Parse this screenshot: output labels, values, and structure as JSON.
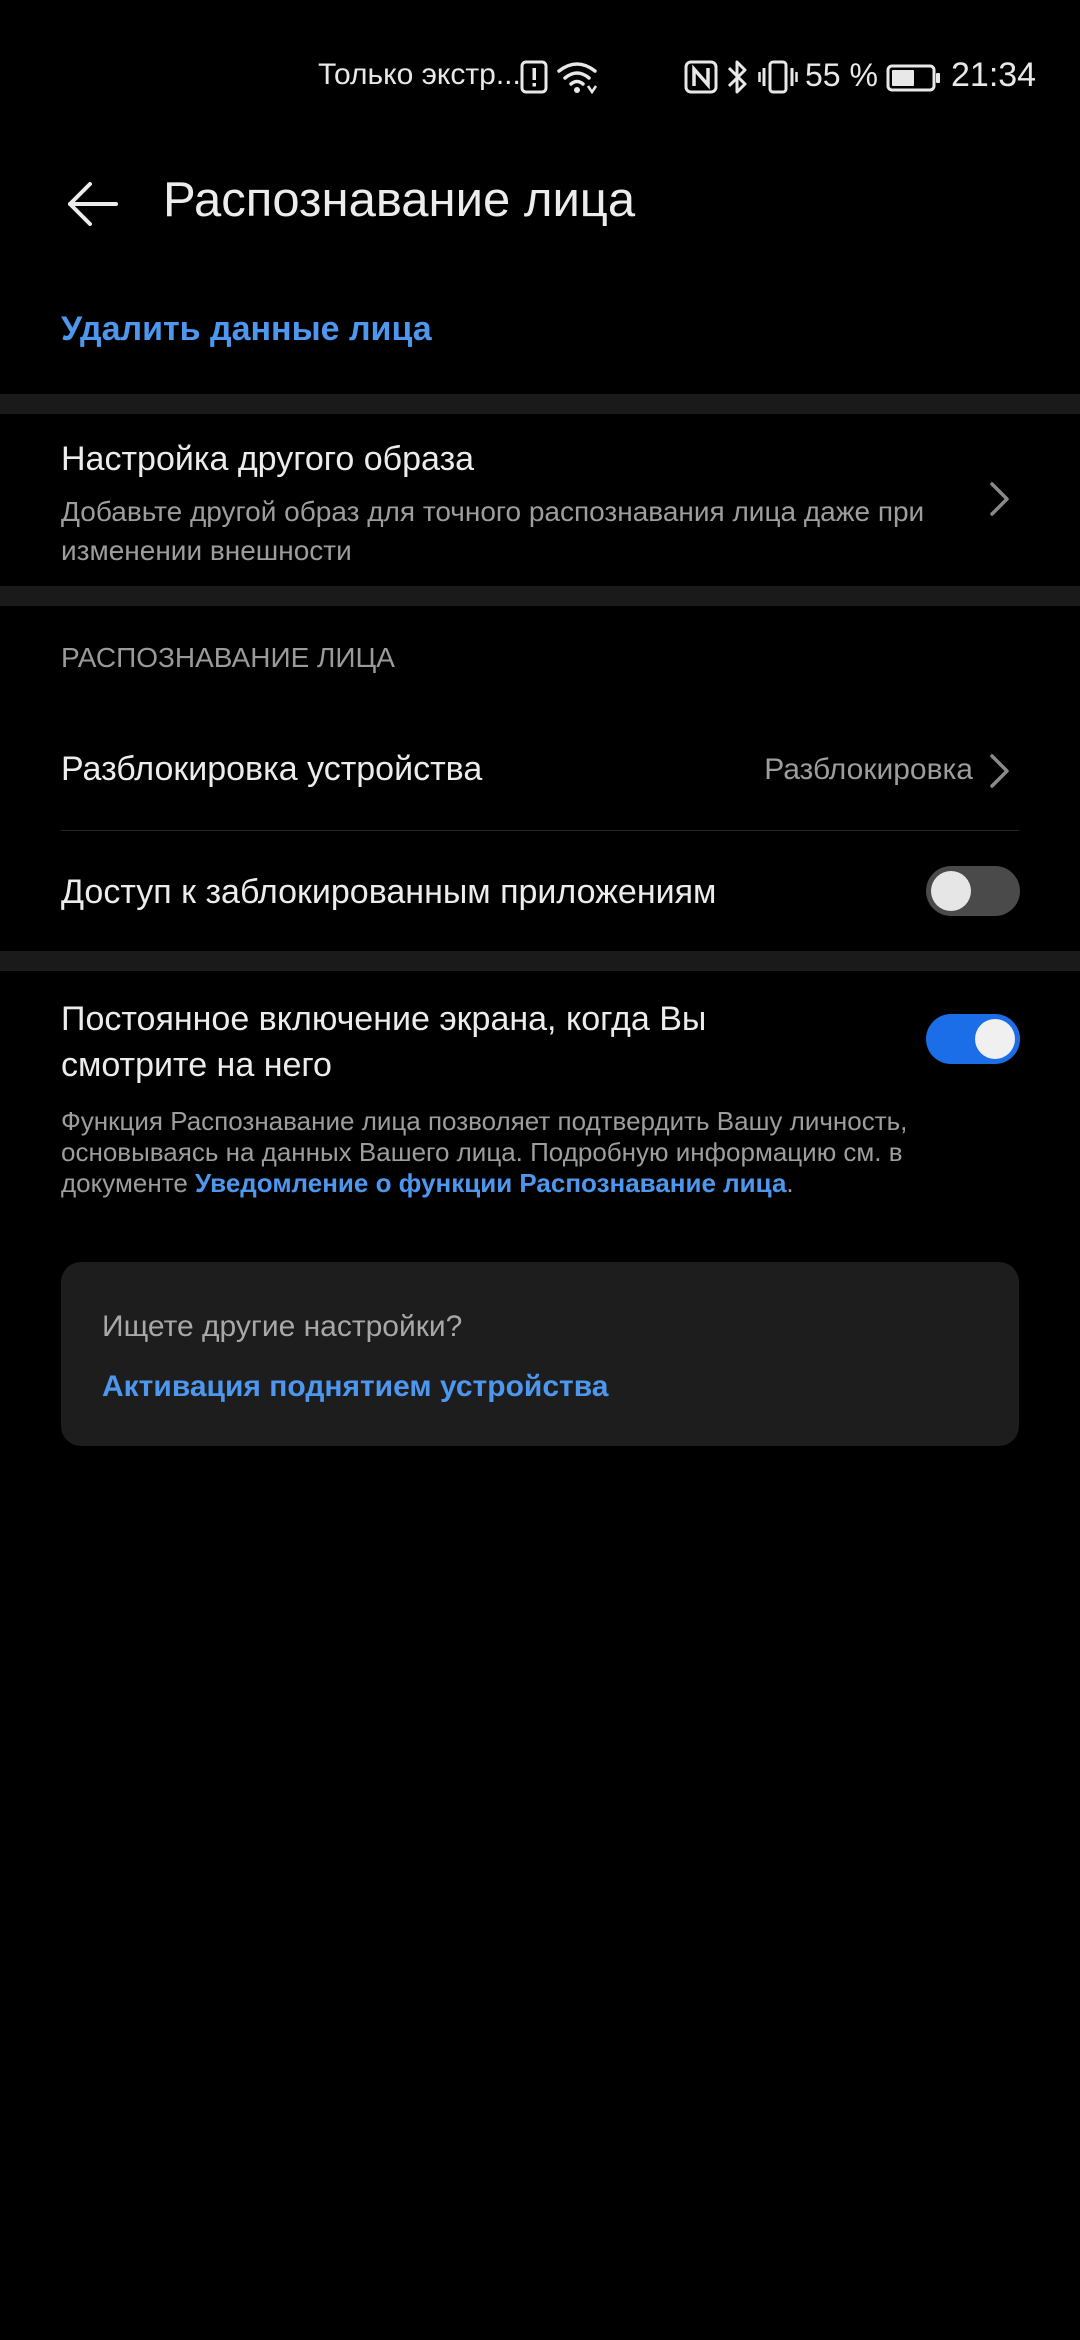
{
  "status_bar": {
    "carrier": "Только экстр...",
    "battery_percent": "55 %",
    "time": "21:34",
    "icons": [
      "alert-icon",
      "wifi-icon",
      "nfc-icon",
      "bluetooth-icon",
      "vibrate-icon",
      "battery-icon"
    ]
  },
  "header": {
    "title": "Распознавание лица",
    "back_icon": "arrow-left-icon"
  },
  "delete_face_data": "Удалить данные лица",
  "alt_appearance": {
    "title": "Настройка другого образа",
    "description": "Добавьте другой образ для точного распознавания лица даже при изменении внешности"
  },
  "section_header": "РАСПОЗНАВАНИЕ ЛИЦА",
  "unlock_device": {
    "label": "Разблокировка устройства",
    "value": "Разблокировка"
  },
  "locked_apps": {
    "label": "Доступ к заблокированным приложениям",
    "enabled": false
  },
  "screen_on": {
    "label": "Постоянное включение экрана, когда Вы смотрите на него",
    "enabled": true
  },
  "feature_note": {
    "text": "Функция Распознавание лица позволяет подтвердить Вашу личность, основываясь на данных Вашего лица. Подробную информацию см. в документе ",
    "link": "Уведомление о функции Распознавание лица",
    "suffix": "."
  },
  "other_settings": {
    "title": "Ищете другие настройки?",
    "link": "Активация поднятием устройства"
  },
  "colors": {
    "background": "#000000",
    "accent": "#4d97ee",
    "toggle_on": "#1c6ee8",
    "card": "#1d1d1d"
  }
}
